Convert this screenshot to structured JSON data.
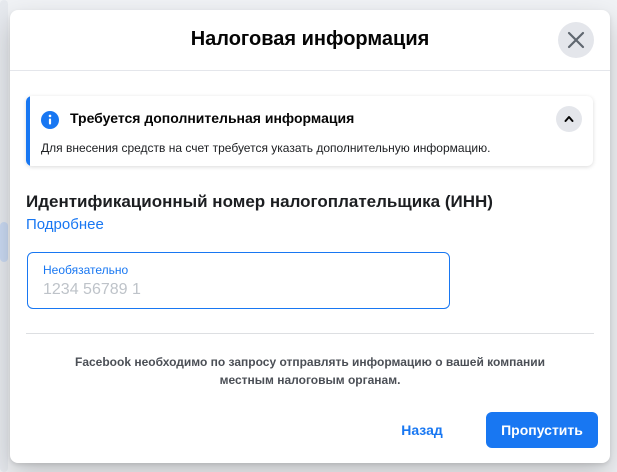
{
  "dialog": {
    "title": "Налоговая информация"
  },
  "notice": {
    "title": "Требуется дополнительная информация",
    "text": "Для внесения средств на счет требуется указать дополнительную информацию."
  },
  "tax_field": {
    "title": "Идентификационный номер налогоплательщика (ИНН)",
    "learn_more": "Подробнее",
    "label": "Необязательно",
    "placeholder": "1234 56789 1",
    "value": ""
  },
  "footer": {
    "note_line1": "Facebook необходимо по запросу отправлять информацию о вашей компании",
    "note_line2": "местным налоговым органам.",
    "back_label": "Назад",
    "skip_label": "Пропустить"
  },
  "colors": {
    "accent": "#1877f2",
    "text": "#050505",
    "secondary_text": "#4b4f56"
  }
}
